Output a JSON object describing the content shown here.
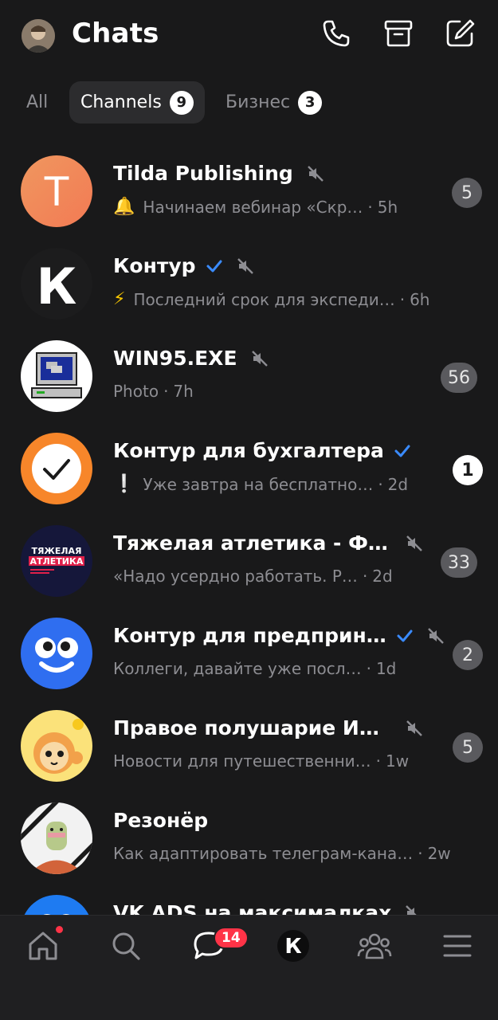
{
  "header": {
    "title": "Chats",
    "icons": [
      "avatar",
      "phone-icon",
      "archive-icon",
      "compose-icon"
    ]
  },
  "filters": [
    {
      "label": "All",
      "count": ""
    },
    {
      "label": "Channels",
      "count": "9"
    },
    {
      "label": "Бизнес",
      "count": "3"
    }
  ],
  "chats": [
    {
      "name": "Tilda Publishing",
      "verified": false,
      "muted": true,
      "emoji": "🔔",
      "preview": "Начинаем вебинар «Скр…",
      "time": "5h",
      "badge": "5",
      "badge_active": false
    },
    {
      "name": "Контур",
      "verified": true,
      "muted": true,
      "emoji": "⚡",
      "preview": "Последний срок для экспеди…",
      "time": "6h",
      "badge": "",
      "badge_active": false
    },
    {
      "name": "WIN95.EXE",
      "verified": false,
      "muted": true,
      "emoji": "",
      "preview": "Photo",
      "time": "7h",
      "badge": "56",
      "badge_active": false
    },
    {
      "name": "Контур для бухгалтера",
      "verified": true,
      "muted": false,
      "emoji": "❕",
      "preview": "Уже завтра на бесплатно…",
      "time": "2d",
      "badge": "1",
      "badge_active": true
    },
    {
      "name": "Тяжелая атлетика - ФТАР",
      "verified": false,
      "muted": true,
      "emoji": "",
      "preview": "«Надо усердно работать. Р…",
      "time": "2d",
      "badge": "33",
      "badge_active": false
    },
    {
      "name": "Контур для предприн…",
      "verified": true,
      "muted": true,
      "emoji": "",
      "preview": "Коллеги, давайте уже посл…",
      "time": "1d",
      "badge": "2",
      "badge_active": false
    },
    {
      "name": "Правое полушарие Интр…",
      "verified": false,
      "muted": true,
      "emoji": "",
      "preview": "Новости для путешественни…",
      "time": "1w",
      "badge": "5",
      "badge_active": false
    },
    {
      "name": "Резонёр",
      "verified": false,
      "muted": false,
      "emoji": "",
      "preview": "Как адаптировать телеграм-кана…",
      "time": "2w",
      "badge": "",
      "badge_active": false
    },
    {
      "name": "VK ADS на максималках",
      "verified": false,
      "muted": true,
      "emoji": "",
      "preview": "",
      "time": "",
      "badge": "",
      "badge_active": false
    }
  ],
  "avatars": {
    "tilda_letter": "T",
    "kontur_letter": "К",
    "tyazh_line1": "ТЯЖЕЛАЯ",
    "tyazh_line2": "АТЛЕТИКА"
  },
  "nav": {
    "items": [
      "home-icon",
      "search-icon",
      "messages-icon",
      "kontur-icon",
      "community-icon",
      "menu-icon"
    ],
    "messages_badge": "14",
    "kontur_letter": "К"
  },
  "colors": {
    "background": "#19191a",
    "badge_muted": "#5a5a5e",
    "badge_active": "#ffffff",
    "verified": "#3a8bff",
    "notification": "#ff3347"
  }
}
